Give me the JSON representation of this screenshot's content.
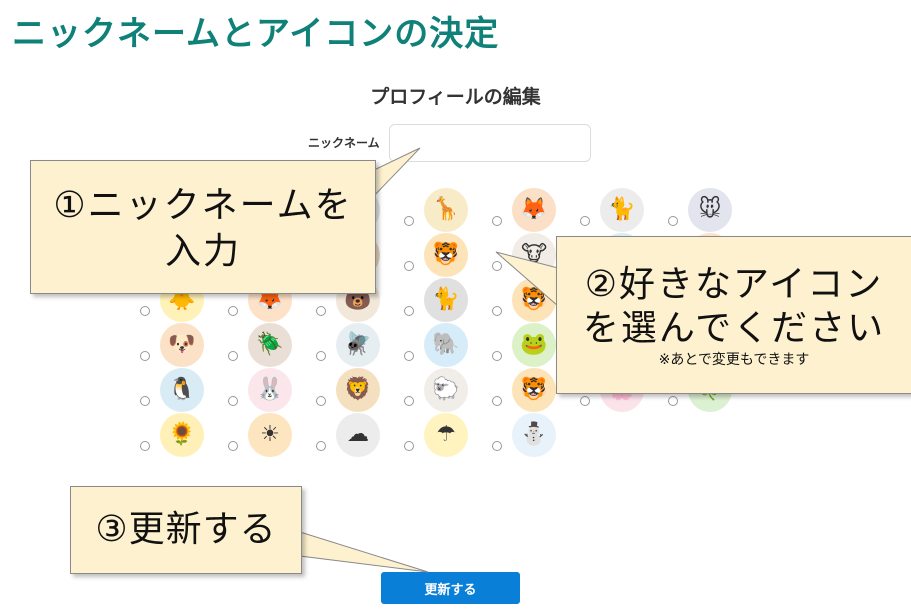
{
  "slide": {
    "title": "ニックネームとアイコンの決定"
  },
  "form": {
    "title": "プロフィールの編集",
    "nickname_label": "ニックネーム",
    "nickname_value": "",
    "submit_label": "更新する"
  },
  "icons": [
    {
      "name": "cat-icon",
      "glyph": "🐱",
      "bg": "#f6e3c9"
    },
    {
      "name": "elephant-icon",
      "glyph": "🐘",
      "bg": "#d6ecf8"
    },
    {
      "name": "koala-icon",
      "glyph": "🐨",
      "bg": "#e4e4ea"
    },
    {
      "name": "giraffe-icon",
      "glyph": "🦒",
      "bg": "#f8ebc8"
    },
    {
      "name": "fox-icon",
      "glyph": "🦊",
      "bg": "#fbe0c7"
    },
    {
      "name": "cat-icon",
      "glyph": "🐈",
      "bg": "#ececec"
    },
    {
      "name": "mouse-icon",
      "glyph": "🐭",
      "bg": "#e2e4ee"
    },
    {
      "name": "cat-icon",
      "glyph": "🐱",
      "bg": "#f1dfcf"
    },
    {
      "name": "hedgehog-icon",
      "glyph": "🦔",
      "bg": "#eedccb"
    },
    {
      "name": "tanuki-icon",
      "glyph": "🦝",
      "bg": "#e7d6c4"
    },
    {
      "name": "tiger-icon",
      "glyph": "🐯",
      "bg": "#fde3b8"
    },
    {
      "name": "cow-icon",
      "glyph": "🐮",
      "bg": "#f1ece6"
    },
    {
      "name": "penguin-icon",
      "glyph": "🐧",
      "bg": "#d9ecf6"
    },
    {
      "name": "fox-icon",
      "glyph": "🦊",
      "bg": "#fde2c8"
    },
    {
      "name": "chick-icon",
      "glyph": "🐥",
      "bg": "#fff2b8"
    },
    {
      "name": "fox-icon",
      "glyph": "🦊",
      "bg": "#fde2c8"
    },
    {
      "name": "bear-icon",
      "glyph": "🐻",
      "bg": "#f1e8da"
    },
    {
      "name": "black-cat-icon",
      "glyph": "🐈",
      "bg": "#e0e0e0"
    },
    {
      "name": "tiger-icon",
      "glyph": "🐯",
      "bg": "#fde3b8"
    },
    {
      "name": "robot-icon",
      "glyph": "🤖",
      "bg": "#e1e8ee"
    },
    {
      "name": "whale-icon",
      "glyph": "🐳",
      "bg": "#d6edf8"
    },
    {
      "name": "dog-icon",
      "glyph": "🐶",
      "bg": "#fbe2c6"
    },
    {
      "name": "beetle-icon",
      "glyph": "🪲",
      "bg": "#eadfd6"
    },
    {
      "name": "dragonfly-icon",
      "glyph": "🪰",
      "bg": "#e6eef2"
    },
    {
      "name": "elephant-icon",
      "glyph": "🐘",
      "bg": "#d6ecf8"
    },
    {
      "name": "frog-icon",
      "glyph": "🐸",
      "bg": "#dcf1c8"
    },
    {
      "name": "horse-icon",
      "glyph": "🐴",
      "bg": "#ecdcc8"
    },
    {
      "name": "panda-icon",
      "glyph": "🐼",
      "bg": "#ececec"
    },
    {
      "name": "penguin-icon",
      "glyph": "🐧",
      "bg": "#d9ecf6"
    },
    {
      "name": "rabbit-icon",
      "glyph": "🐰",
      "bg": "#fbe6ec"
    },
    {
      "name": "lion-icon",
      "glyph": "🦁",
      "bg": "#f4dfbf"
    },
    {
      "name": "sheep-icon",
      "glyph": "🐑",
      "bg": "#f1ede8"
    },
    {
      "name": "tiger-icon",
      "glyph": "🐯",
      "bg": "#fde3b8"
    },
    {
      "name": "sakura-icon",
      "glyph": "🌸",
      "bg": "#fbe3ea"
    },
    {
      "name": "clover-icon",
      "glyph": "🍀",
      "bg": "#dcf0d2"
    },
    {
      "name": "sunflower-icon",
      "glyph": "🌻",
      "bg": "#fff0b8"
    },
    {
      "name": "sun-icon",
      "glyph": "☀",
      "bg": "#fde6bf"
    },
    {
      "name": "cloud-icon",
      "glyph": "☁",
      "bg": "#ececec"
    },
    {
      "name": "umbrella-icon",
      "glyph": "☂",
      "bg": "#fff4c0"
    },
    {
      "name": "snowman-icon",
      "glyph": "⛄",
      "bg": "#e8f2fa"
    }
  ],
  "callouts": {
    "step1_line1": "①ニックネームを",
    "step1_line2": "入力",
    "step2_line1": "②好きなアイコン",
    "step2_line2": "を選んでください",
    "step2_note": "※あとで変更もできます",
    "step3": "③更新する"
  }
}
